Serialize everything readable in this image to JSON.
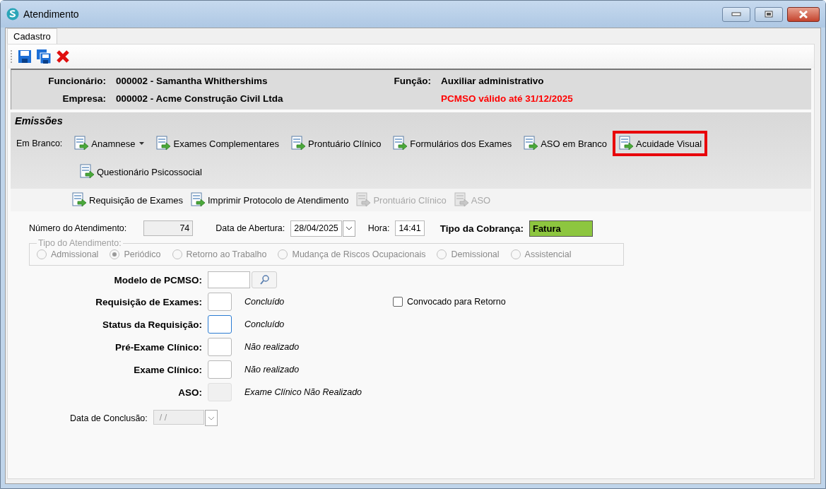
{
  "window": {
    "title": "Atendimento"
  },
  "tabs": [
    {
      "label": "Cadastro",
      "selected": true
    }
  ],
  "info": {
    "employee": {
      "label": "Funcionário:",
      "value": "000002 - Samantha Whithershims"
    },
    "company": {
      "label": "Empresa:",
      "value": "000002 - Acme Construção Civil Ltda"
    },
    "role": {
      "label": "Função:",
      "value": "Auxiliar administrativo"
    },
    "notice": "PCMSO válido até 31/12/2025"
  },
  "emissions": {
    "title": "Emissões",
    "blank_label": "Em Branco:",
    "items": [
      {
        "label": "Anamnese",
        "dropdown": true,
        "highlighted": false,
        "disabled": false
      },
      {
        "label": "Exames Complementares",
        "dropdown": false,
        "highlighted": false,
        "disabled": false
      },
      {
        "label": "Prontuário Clínico",
        "dropdown": false,
        "highlighted": false,
        "disabled": false
      },
      {
        "label": "Formulários dos Exames",
        "dropdown": false,
        "highlighted": false,
        "disabled": false
      },
      {
        "label": "ASO em Branco",
        "dropdown": false,
        "highlighted": false,
        "disabled": false
      },
      {
        "label": "Acuidade Visual",
        "dropdown": false,
        "highlighted": true,
        "disabled": false
      },
      {
        "label": "Questionário Psicossocial",
        "dropdown": false,
        "highlighted": false,
        "disabled": false
      }
    ],
    "actions": [
      {
        "label": "Requisição de Exames",
        "disabled": false
      },
      {
        "label": "Imprimir Protocolo de Atendimento",
        "disabled": false
      },
      {
        "label": "Prontuário Clínico",
        "disabled": true
      },
      {
        "label": "ASO",
        "disabled": true
      }
    ]
  },
  "header_fields": {
    "number": {
      "label": "Número do Atendimento:",
      "value": "74"
    },
    "opening_date": {
      "label": "Data de Abertura:",
      "value": "28/04/2025"
    },
    "time": {
      "label": "Hora:",
      "value": "14:41"
    },
    "billing": {
      "label": "Tipo da Cobrança:",
      "value": "Fatura"
    }
  },
  "attendance_type": {
    "legend": "Tipo do Atendimento:",
    "disabled": true,
    "options": [
      {
        "label": "Admissional",
        "selected": false
      },
      {
        "label": "Periódico",
        "selected": true
      },
      {
        "label": "Retorno ao Trabalho",
        "selected": false
      },
      {
        "label": "Mudança de Riscos Ocupacionais",
        "selected": false
      },
      {
        "label": "Demissional",
        "selected": false
      },
      {
        "label": "Assistencial",
        "selected": false
      }
    ]
  },
  "pcmso_model": {
    "label": "Modelo de PCMSO:"
  },
  "recall": {
    "label": "Convocado para Retorno",
    "checked": false
  },
  "statuses": [
    {
      "label": "Requisição de Exames:",
      "status": "Concluído",
      "focused": false,
      "disabled": false
    },
    {
      "label": "Status da Requisição:",
      "status": "Concluído",
      "focused": true,
      "disabled": false
    },
    {
      "label": "Pré-Exame Clínico:",
      "status": "Não realizado",
      "focused": false,
      "disabled": false
    },
    {
      "label": "Exame Clínico:",
      "status": "Não realizado",
      "focused": false,
      "disabled": false
    },
    {
      "label": "ASO:",
      "status": "Exame Clínico Não Realizado",
      "focused": false,
      "disabled": true
    }
  ],
  "completion_date": {
    "label": "Data de Conclusão:",
    "value": "/ /",
    "disabled": true
  }
}
